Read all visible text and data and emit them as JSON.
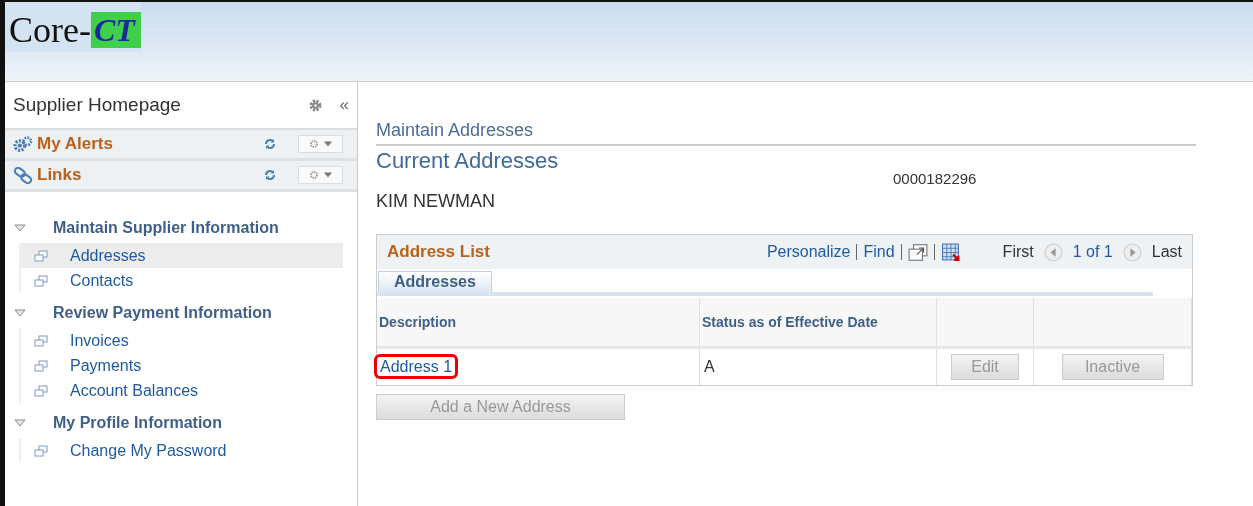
{
  "logo": {
    "text": "Core-",
    "mark": "CT"
  },
  "sidebar": {
    "title": "Supplier Homepage",
    "collapse": "«",
    "pagelets": [
      {
        "title": "My Alerts",
        "kind": "alerts"
      },
      {
        "title": "Links",
        "kind": "links"
      }
    ],
    "groups": [
      {
        "label": "Maintain Supplier Information",
        "expanded": true,
        "children": [
          {
            "label": "Addresses",
            "selected": true
          },
          {
            "label": "Contacts",
            "selected": false
          }
        ]
      },
      {
        "label": "Review Payment Information",
        "expanded": true,
        "children": [
          {
            "label": "Invoices",
            "selected": false
          },
          {
            "label": "Payments",
            "selected": false
          },
          {
            "label": "Account Balances",
            "selected": false
          }
        ]
      },
      {
        "label": "My Profile Information",
        "expanded": true,
        "children": [
          {
            "label": "Change My Password",
            "selected": false
          }
        ]
      }
    ]
  },
  "main": {
    "breadcrumb": "Maintain Addresses",
    "title": "Current Addresses",
    "supplier_id": "0000182296",
    "supplier_name": "KIM NEWMAN",
    "grid": {
      "title": "Address List",
      "personalize": "Personalize",
      "find": "Find",
      "first": "First",
      "count": "1 of 1",
      "last": "Last",
      "tabs": [
        {
          "label": "Addresses",
          "selected": true
        }
      ],
      "columns": [
        "Description",
        "Status as of Effective Date"
      ],
      "rows": [
        {
          "description": "Address 1",
          "highlighted": true,
          "status": "A",
          "buttons": [
            {
              "label": "Edit",
              "disabled": true
            },
            {
              "label": "Inactive",
              "disabled": true
            }
          ]
        }
      ]
    },
    "add_button": {
      "label": "Add a New Address",
      "disabled": true
    }
  }
}
